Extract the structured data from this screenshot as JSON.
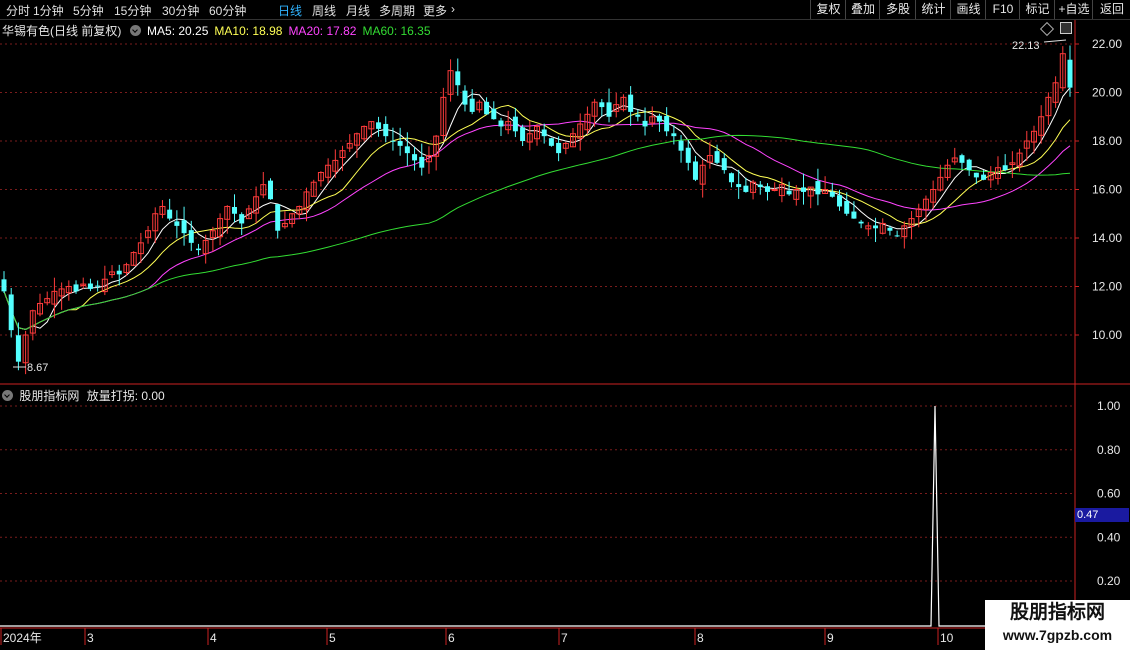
{
  "toolbar": {
    "tabs": [
      "分时",
      "1分钟",
      "5分钟",
      "15分钟",
      "30分钟",
      "60分钟",
      "日线",
      "周线",
      "月线",
      "多周期",
      "更多"
    ],
    "active_tab": "日线",
    "more_arrow": "›",
    "right_buttons": [
      "复权",
      "叠加",
      "多股",
      "统计",
      "画线",
      "F10",
      "标记",
      "+自选",
      "返回"
    ]
  },
  "main_legend": {
    "stock": "华锡有色(日线 前复权)",
    "ma": [
      {
        "label": "MA5: 20.25",
        "color": "#ffffff"
      },
      {
        "label": "MA10: 18.98",
        "color": "#ffff55"
      },
      {
        "label": "MA20: 17.82",
        "color": "#ff44ff"
      },
      {
        "label": "MA60: 16.35",
        "color": "#33dd33"
      }
    ]
  },
  "sub_legend": {
    "name": "股朋指标网",
    "indicator": "放量打拐: 0.00"
  },
  "price_axis": [
    "22.00",
    "20.00",
    "18.00",
    "16.00",
    "14.00",
    "12.00",
    "10.00"
  ],
  "indicator_axis": [
    "1.00",
    "0.80",
    "0.60",
    "0.40",
    "0.20"
  ],
  "indicator_value_badge": "0.47",
  "annotations": {
    "high": "22.13",
    "low": "8.67"
  },
  "date_axis": [
    "2024年",
    "3",
    "4",
    "5",
    "6",
    "7",
    "8",
    "9",
    "10"
  ],
  "watermark": {
    "line1": "股朋指标网",
    "line2": "www.7gpzb.com"
  },
  "colors": {
    "up": "#ff3b3b",
    "down": "#54ffff",
    "grid": "#7a1c1c",
    "axis": "#cc2222"
  },
  "chart_data": {
    "type": "candlestick",
    "price_range": [
      8.0,
      22.5
    ],
    "series_closes_approx": [
      11.8,
      10.2,
      8.9,
      10.0,
      11.0,
      11.3,
      11.5,
      11.8,
      11.9,
      12.0,
      11.8,
      12.1,
      11.9,
      12.0,
      12.3,
      12.6,
      12.5,
      12.9,
      13.4,
      13.8,
      14.3,
      15.0,
      15.3,
      14.8,
      14.5,
      14.2,
      13.8,
      13.5,
      13.9,
      14.3,
      14.8,
      15.3,
      15.0,
      14.6,
      15.2,
      15.7,
      16.2,
      15.6,
      14.3,
      14.6,
      15.0,
      15.3,
      15.9,
      16.3,
      16.7,
      17.0,
      17.2,
      17.6,
      17.9,
      18.3,
      18.6,
      18.8,
      18.5,
      18.2,
      18.0,
      17.8,
      17.5,
      17.2,
      16.9,
      17.4,
      18.2,
      19.8,
      20.9,
      20.3,
      19.5,
      19.2,
      19.6,
      19.1,
      18.9,
      18.6,
      18.8,
      18.4,
      18.0,
      18.3,
      18.6,
      18.2,
      17.8,
      17.5,
      17.9,
      18.3,
      18.7,
      19.1,
      19.6,
      19.4,
      19.0,
      19.5,
      19.8,
      19.2,
      19.0,
      18.6,
      19.0,
      18.8,
      18.4,
      18.2,
      17.6,
      17.1,
      16.4,
      17.0,
      17.4,
      17.1,
      16.8,
      16.3,
      16.1,
      15.9,
      16.3,
      16.1,
      15.9,
      16.0,
      16.2,
      15.8,
      16.0,
      15.9,
      16.1,
      15.8,
      16.0,
      15.7,
      15.3,
      15.0,
      14.8,
      14.6,
      14.5,
      14.4,
      14.6,
      14.3,
      14.1,
      14.5,
      14.8,
      15.2,
      15.6,
      16.0,
      16.5,
      17.0,
      17.3,
      17.1,
      16.8,
      16.5,
      16.4,
      16.7,
      16.9,
      16.8,
      17.1,
      17.5,
      18.0,
      18.4,
      19.0,
      19.8,
      20.4,
      21.6,
      20.2
    ]
  },
  "indicator_data": {
    "type": "line",
    "signal_index": 131,
    "signal_value": 1.0,
    "baseline": 0.0
  }
}
